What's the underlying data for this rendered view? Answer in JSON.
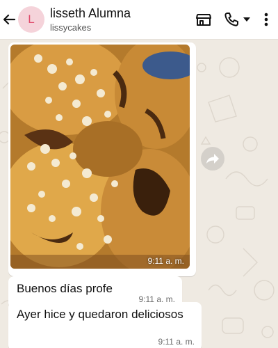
{
  "header": {
    "title": "lisseth Alumna",
    "subtitle": "lissycakes",
    "avatar_letter": "L",
    "icons": [
      "back-arrow-icon",
      "store-icon",
      "phone-icon",
      "dropdown-icon",
      "more-icon"
    ]
  },
  "messages": [
    {
      "type": "image",
      "time": "9:11 a. m."
    },
    {
      "type": "text",
      "text": "Buenos días profe",
      "time": "9:11 a. m."
    },
    {
      "type": "text",
      "text": "Ayer hice y quedaron deliciosos",
      "time": "9:11 a. m."
    }
  ],
  "colors": {
    "accent": "#e04a6b",
    "background": "#efeae2"
  }
}
